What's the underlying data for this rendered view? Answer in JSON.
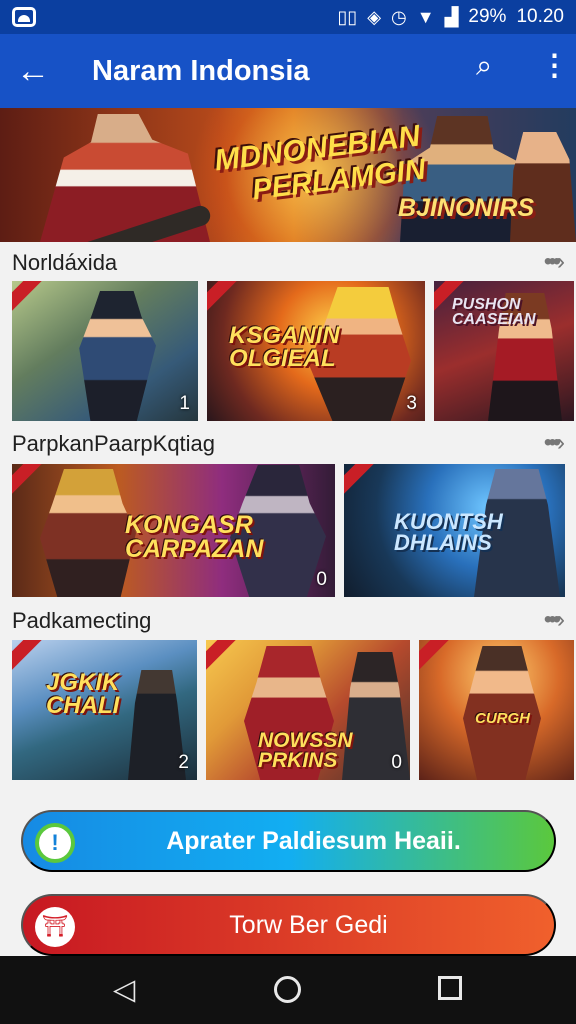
{
  "status": {
    "icons": [
      "vibrate-icon",
      "nfc-icon",
      "alarm-icon",
      "wifi-icon",
      "signal-icon"
    ],
    "battery": "29%",
    "time": "10.20"
  },
  "appbar": {
    "title": "Naram Indonsia"
  },
  "banner": {
    "line1": "MDNONEBIAN",
    "line2": "PERLAMGIN",
    "line3": "BJINONIRS"
  },
  "sections": [
    {
      "title": "Norldáxida",
      "cards": [
        {
          "label": "",
          "count": "1"
        },
        {
          "label": "KSGANIN OLGIEAL",
          "count": "3"
        },
        {
          "label": "PUSHON CAASEIAN",
          "count": ""
        }
      ]
    },
    {
      "title": "ParpkanPaarpKqtiag",
      "cards": [
        {
          "label": "KONGASR CARPAZAN",
          "count": "0"
        },
        {
          "label": "KUONTSH DHLAINS",
          "count": ""
        }
      ]
    },
    {
      "title": "Padkamecting",
      "cards": [
        {
          "label": "JGKIK CHALI",
          "count": "2"
        },
        {
          "label": "NOWSSN PRKINS",
          "count": "0"
        },
        {
          "label": "CURGH",
          "count": ""
        }
      ]
    }
  ],
  "buttons": {
    "primary": "Aprater Paldiesum Heaii.",
    "secondary": "Torw Ber Gedi"
  },
  "colors": {
    "status_bar": "#0b3fa0",
    "app_bar": "#1752c6",
    "primary_start": "#168ae3",
    "primary_end": "#5bc83d",
    "secondary_start": "#c71822",
    "secondary_end": "#f0602c"
  }
}
